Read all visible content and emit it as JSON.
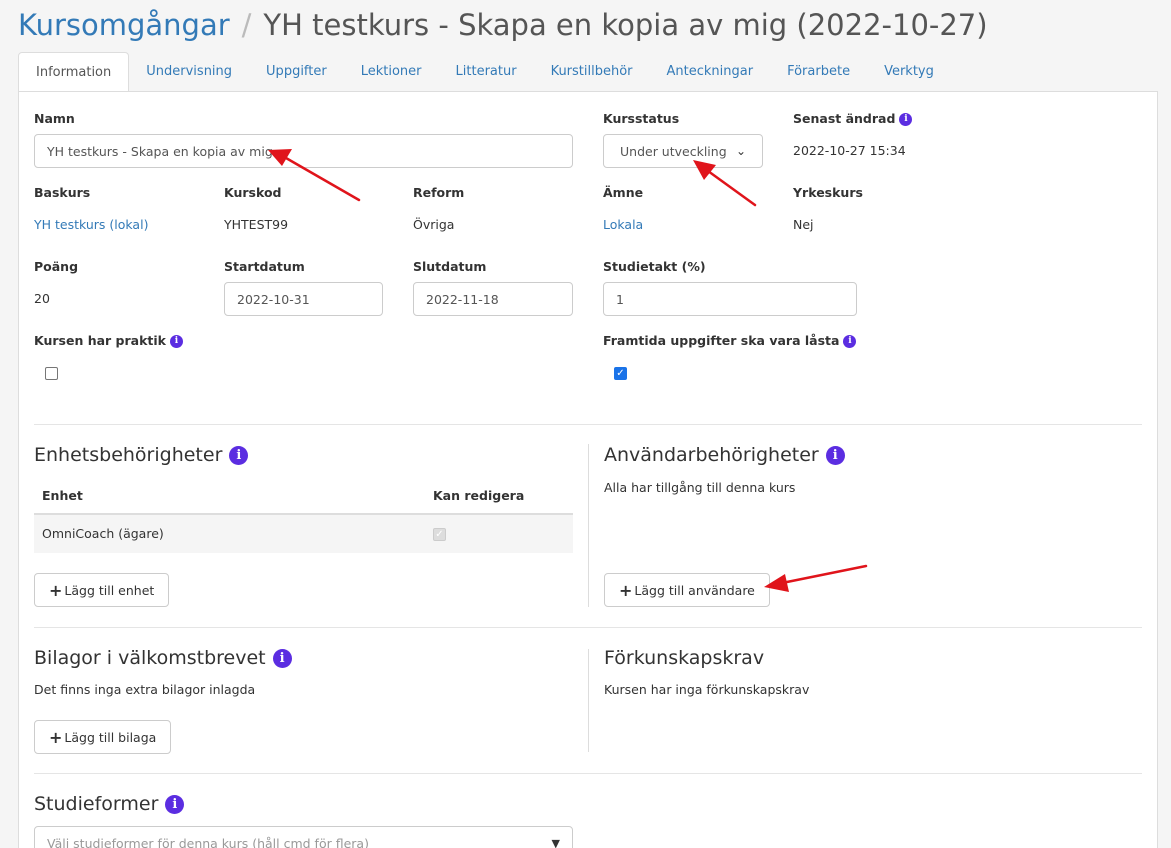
{
  "breadcrumb": {
    "parent": "Kursomgångar",
    "separator": "/",
    "title": "YH testkurs - Skapa en kopia av mig (2022-10-27)"
  },
  "tabs": [
    {
      "label": "Information",
      "active": true
    },
    {
      "label": "Undervisning"
    },
    {
      "label": "Uppgifter"
    },
    {
      "label": "Lektioner"
    },
    {
      "label": "Litteratur"
    },
    {
      "label": "Kurstillbehör"
    },
    {
      "label": "Anteckningar"
    },
    {
      "label": "Förarbete"
    },
    {
      "label": "Verktyg"
    }
  ],
  "form": {
    "namn": {
      "label": "Namn",
      "value": "YH testkurs - Skapa en kopia av mig"
    },
    "kursstatus": {
      "label": "Kursstatus",
      "value": "Under utveckling"
    },
    "senast_andrad": {
      "label": "Senast ändrad",
      "value": "2022-10-27 15:34"
    },
    "baskurs": {
      "label": "Baskurs",
      "value": "YH testkurs (lokal)"
    },
    "kurskod": {
      "label": "Kurskod",
      "value": "YHTEST99"
    },
    "reform": {
      "label": "Reform",
      "value": "Övriga"
    },
    "amne": {
      "label": "Ämne",
      "value": "Lokala"
    },
    "yrkeskurs": {
      "label": "Yrkeskurs",
      "value": "Nej"
    },
    "poang": {
      "label": "Poäng",
      "value": "20"
    },
    "startdatum": {
      "label": "Startdatum",
      "value": "2022-10-31"
    },
    "slutdatum": {
      "label": "Slutdatum",
      "value": "2022-11-18"
    },
    "studietakt": {
      "label": "Studietakt (%)",
      "value": "1"
    },
    "praktik": {
      "label": "Kursen har praktik",
      "checked": false
    },
    "lasta": {
      "label": "Framtida uppgifter ska vara låsta",
      "checked": true
    }
  },
  "enhets": {
    "title": "Enhetsbehörigheter",
    "col_enhet": "Enhet",
    "col_redigera": "Kan redigera",
    "rows": [
      {
        "enhet": "OmniCoach (ägare)",
        "kan_redigera": true
      }
    ],
    "add_button": "Lägg till enhet"
  },
  "anvandar": {
    "title": "Användarbehörigheter",
    "text": "Alla har tillgång till denna kurs",
    "add_button": "Lägg till användare"
  },
  "bilagor": {
    "title": "Bilagor i välkomstbrevet",
    "text": "Det finns inga extra bilagor inlagda",
    "add_button": "Lägg till bilaga"
  },
  "forkunskap": {
    "title": "Förkunskapskrav",
    "text": "Kursen har inga förkunskapskrav"
  },
  "studieformer": {
    "title": "Studieformer",
    "placeholder": "Välj studieformer för denna kurs (håll cmd för flera)"
  },
  "icons": {
    "info": "info-circle-icon",
    "plus": "plus-icon",
    "chevron": "chevron-down-icon",
    "arrow": "red-arrow-annotation"
  },
  "colors": {
    "link": "#337ab7",
    "info": "#5b2de1",
    "arrow": "#e0141b"
  }
}
